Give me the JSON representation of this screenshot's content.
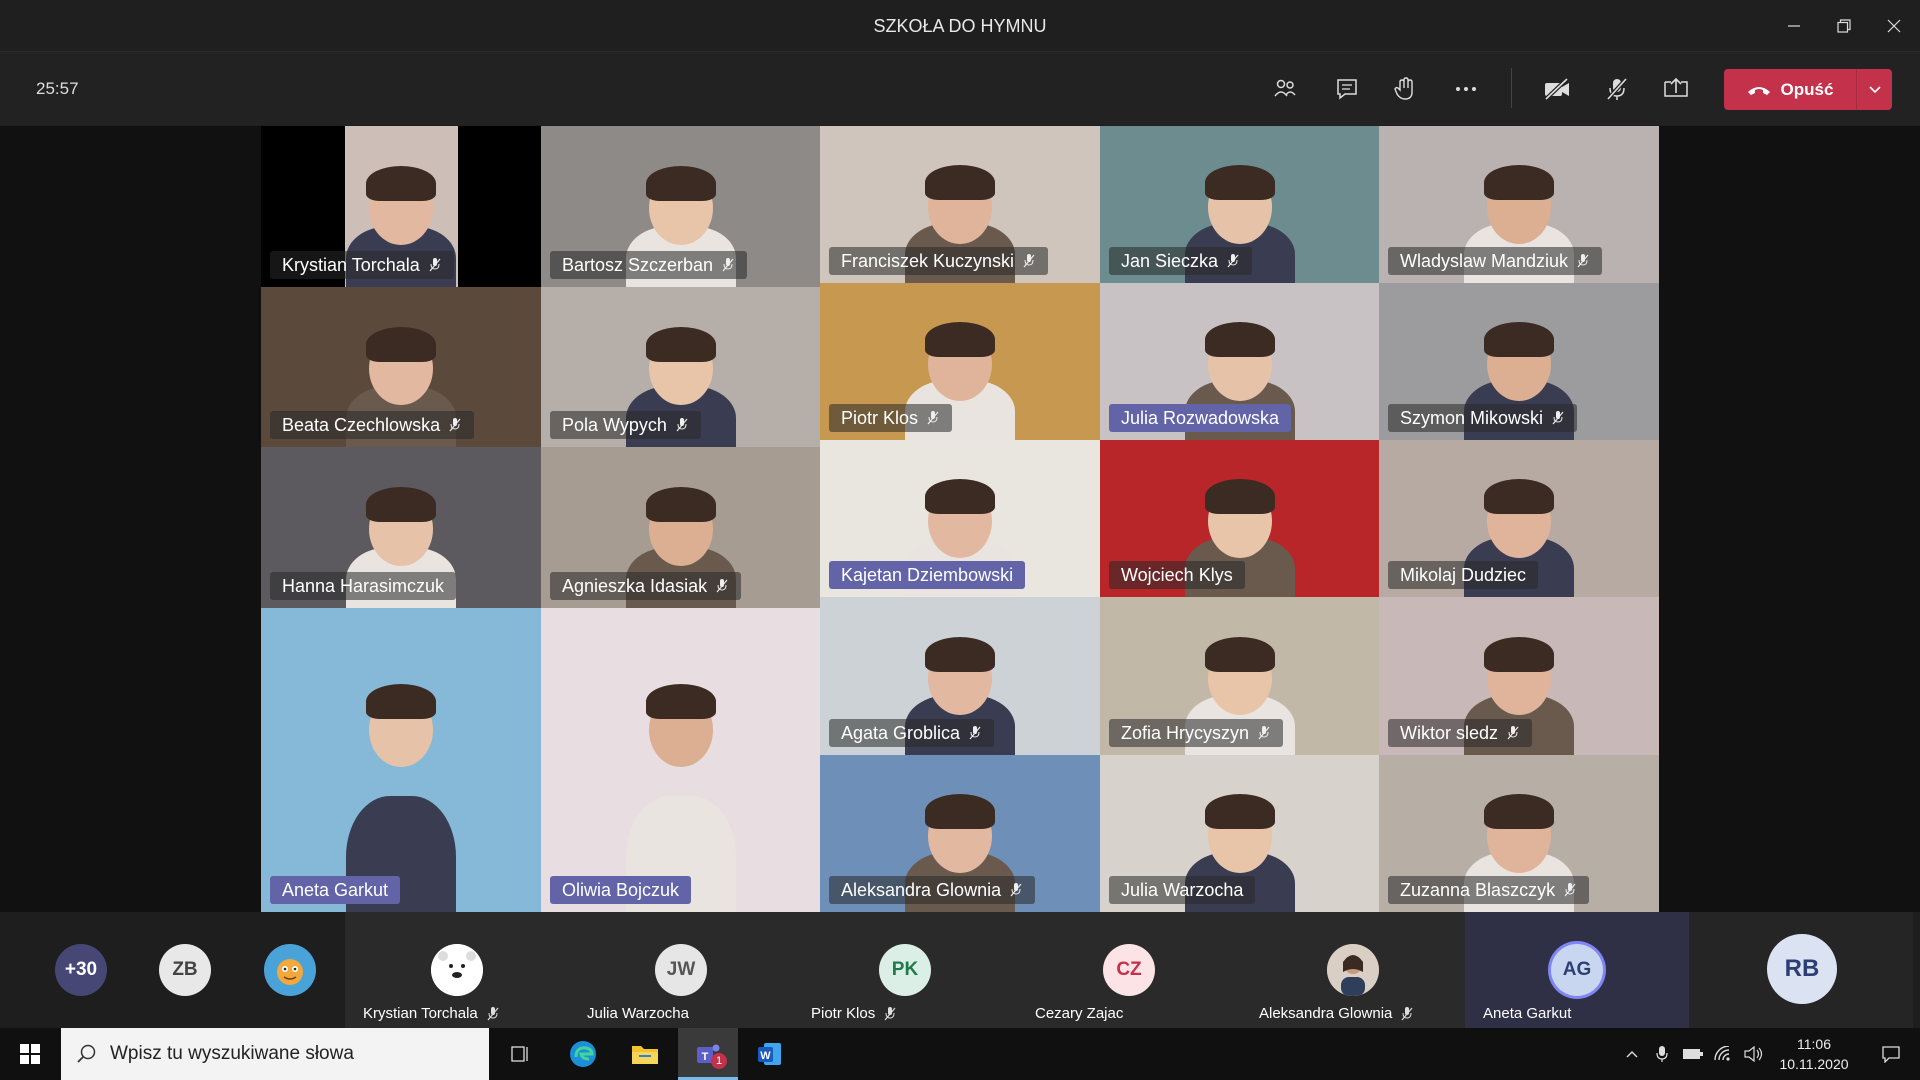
{
  "window": {
    "title": "SZKOŁA DO HYMNU",
    "controls": [
      "minimize",
      "restore",
      "close"
    ]
  },
  "toolbar": {
    "timer": "25:57",
    "buttons": [
      "people-icon",
      "chat-icon",
      "raise-hand-icon",
      "more-options-icon",
      "camera-off-icon",
      "mic-off-icon",
      "share-screen-icon"
    ],
    "leave_label": "Opuść",
    "leave_color": "#c4314b"
  },
  "tiles": [
    {
      "name": "Krystian Torchala",
      "muted": true,
      "speaking": false
    },
    {
      "name": "Bartosz Szczerban",
      "muted": true,
      "speaking": false
    },
    {
      "name": "Franciszek Kuczynski",
      "muted": true,
      "speaking": false
    },
    {
      "name": "Jan Sieczka",
      "muted": true,
      "speaking": false
    },
    {
      "name": "Wladyslaw Mandziuk",
      "muted": true,
      "speaking": false
    },
    {
      "name": "Beata Czechlowska",
      "muted": true,
      "speaking": false
    },
    {
      "name": "Pola Wypych",
      "muted": true,
      "speaking": false
    },
    {
      "name": "Piotr Klos",
      "muted": true,
      "speaking": false
    },
    {
      "name": "Julia Rozwadowska",
      "muted": false,
      "speaking": true
    },
    {
      "name": "Szymon Mikowski",
      "muted": true,
      "speaking": false
    },
    {
      "name": "Kajetan Dziembowski",
      "muted": false,
      "speaking": true
    },
    {
      "name": "Wojciech Klys",
      "muted": false,
      "speaking": false
    },
    {
      "name": "Mikolaj Dudziec",
      "muted": false,
      "speaking": false
    },
    {
      "name": "Hanna Harasimczuk",
      "muted": false,
      "speaking": false
    },
    {
      "name": "Agnieszka Idasiak",
      "muted": true,
      "speaking": false
    },
    {
      "name": "Agata Groblica",
      "muted": true,
      "speaking": false
    },
    {
      "name": "Zofia Hrycyszyn",
      "muted": true,
      "speaking": false
    },
    {
      "name": "Wiktor sledz",
      "muted": true,
      "speaking": false
    },
    {
      "name": "Aneta Garkut",
      "muted": false,
      "speaking": true
    },
    {
      "name": "Oliwia Bojczuk",
      "muted": false,
      "speaking": true
    },
    {
      "name": "Aleksandra Glownia",
      "muted": true,
      "speaking": false
    },
    {
      "name": "Julia Warzocha",
      "muted": false,
      "speaking": false
    },
    {
      "name": "Zuzanna Blaszczyk",
      "muted": true,
      "speaking": false
    }
  ],
  "bottom": {
    "overflow_count": "+30",
    "small_avatars": [
      "ZB"
    ],
    "participants": [
      {
        "name": "Krystian Torchala",
        "initials": "",
        "muted": true
      },
      {
        "name": "Julia Warzocha",
        "initials": "JW",
        "muted": false
      },
      {
        "name": "Piotr Klos",
        "initials": "PK",
        "muted": true
      },
      {
        "name": "Cezary Zajac",
        "initials": "CZ",
        "muted": false
      },
      {
        "name": "Aleksandra Glownia",
        "initials": "",
        "muted": true
      },
      {
        "name": "Aneta Garkut",
        "initials": "AG",
        "muted": false
      }
    ],
    "last_avatar": "RB"
  },
  "taskbar": {
    "search_placeholder": "Wpisz tu wyszukiwane słowa",
    "teams_badge": "1",
    "time": "11:06",
    "date": "10.11.2020"
  }
}
